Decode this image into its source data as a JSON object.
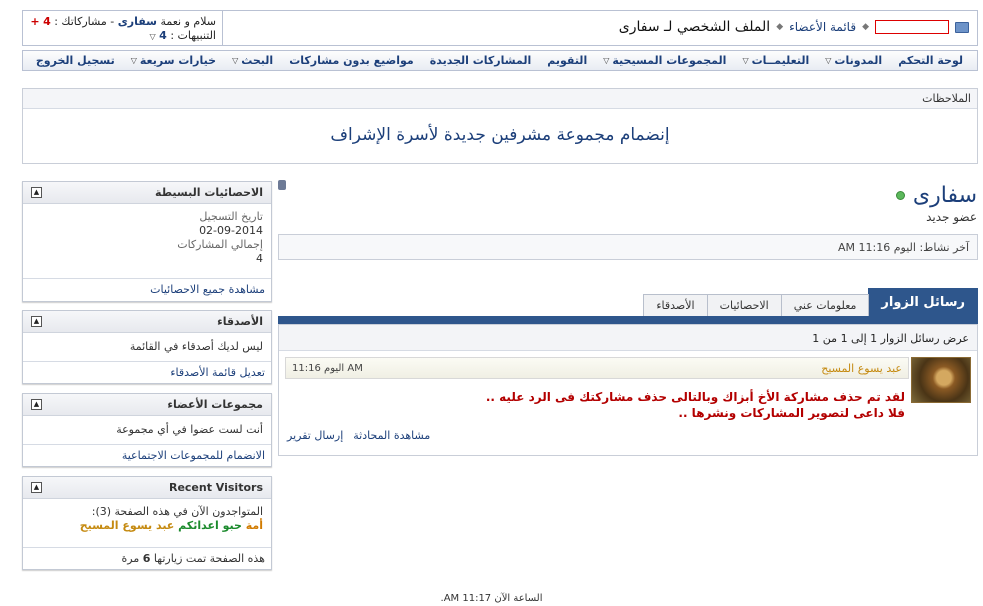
{
  "welcome": {
    "greeting_prefix": "سلام و نعمة",
    "username": "سفارى",
    "posts_label": "- مشاركاتك :",
    "posts_value": "4",
    "plus": "+",
    "notifications_label": "التنبيهات :",
    "notifications_value": "4"
  },
  "breadcrumb": {
    "members_list": "قائمة الأعضاء",
    "title": "الملف الشخصي لـ سفارى"
  },
  "nav": [
    {
      "label": "لوحة التحكم",
      "chev": false
    },
    {
      "label": "المدونات",
      "chev": true
    },
    {
      "label": "التعليمــات",
      "chev": true
    },
    {
      "label": "المجموعات المسيحية",
      "chev": true
    },
    {
      "label": "التقويم",
      "chev": false
    },
    {
      "label": "المشاركات الجديدة",
      "chev": false
    },
    {
      "label": "مواضيع بدون مشاركات",
      "chev": false
    },
    {
      "label": "البحث",
      "chev": true
    },
    {
      "label": "خيارات سريعة",
      "chev": true
    },
    {
      "label": "تسجيل الخروج",
      "chev": false
    }
  ],
  "notices": {
    "title": "الملاحظات",
    "text": "إنضمام مجموعة مشرفين جديدة لأسرة الإشراف"
  },
  "profile": {
    "name": "سفارى",
    "rank": "عضو جديد",
    "last_activity_label": "آخر نشاط:",
    "last_activity_value": "اليوم 11:16 AM"
  },
  "tabs": [
    "رسائل الزوار",
    "معلومات عني",
    "الاحصائيات",
    "الأصدقاء"
  ],
  "visitor_messages": {
    "header": "عرض رسائل الزوار 1 إلى 1 من 1",
    "author": "عبد يسوع المسيح",
    "time": "اليوم 11:16 AM",
    "line1": "لقد تم حذف مشاركة الأخ أبزاك وبالتالى حذف مشاركتك فى الرد عليه ..",
    "line2": "فلا داعى لتصوير المشاركات ونشرها ..",
    "action_conversation": "مشاهدة المحادثة",
    "action_report": "إرسال تقرير"
  },
  "sidebar": {
    "stats": {
      "title": "الاحصائيات البسيطة",
      "join_label": "تاريخ التسجيل",
      "join_value": "02-09-2014",
      "posts_label": "إجمالي المشاركات",
      "posts_value": "4",
      "link": "مشاهدة جميع الاحصائيات"
    },
    "friends": {
      "title": "الأصدقاء",
      "text": "ليس لديك أصدقاء في القائمة",
      "link": "تعديل قائمة الأصدقاء"
    },
    "groups": {
      "title": "مجموعات الأعضاء",
      "text": "أنت لست عضوا في أي مجموعة",
      "link": "الانضمام للمجموعات الاجتماعية"
    },
    "visitors": {
      "title": "Recent Visitors",
      "online_label": "المتواجدون الآن في هذه الصفحة (3):",
      "user1": "أمة",
      "user2": "حبو اعدائكم",
      "user3": "عبد يسوع المسيح",
      "views_prefix": "هذه الصفحة تمت زيارتها",
      "views_value": "6",
      "views_suffix": "مرة"
    }
  },
  "footer": {
    "time": "الساعة الآن 11:17 AM."
  },
  "colors": {
    "link": "#1c3f7a",
    "tab_active": "#2e568c",
    "alert_text": "#b30000",
    "author": "#c58a10"
  }
}
